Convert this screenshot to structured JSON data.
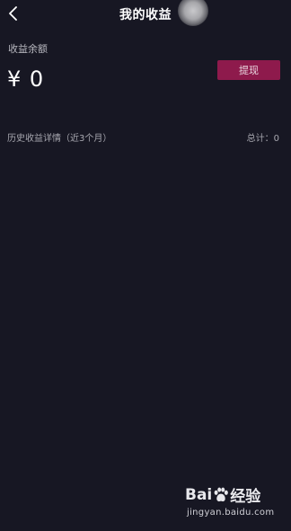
{
  "header": {
    "title": "我的收益",
    "back_icon": "chevron-left-icon"
  },
  "balance": {
    "label": "收益余额",
    "amount": "¥ 0"
  },
  "withdraw": {
    "label": "提现"
  },
  "history": {
    "label": "历史收益详情（近3个月）",
    "total": "总计：0"
  },
  "watermark": {
    "brand_prefix": "Bai",
    "brand_suffix": "经验",
    "url": "jingyan.baidu.com",
    "icon": "paw-icon"
  },
  "colors": {
    "background": "#171723",
    "accent": "#8e1a4c"
  }
}
